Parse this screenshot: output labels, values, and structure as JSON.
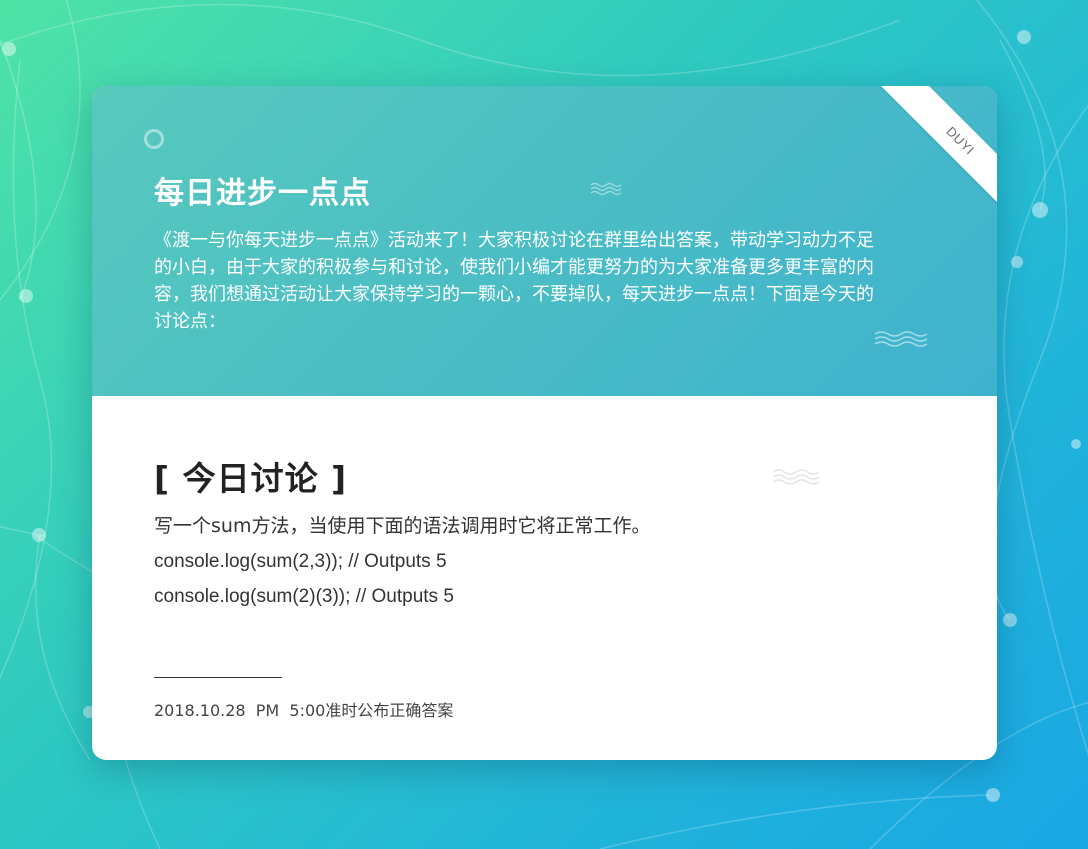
{
  "colors": {
    "background_start": "#4fe3a6",
    "background_end": "#19a7e4",
    "header_start": "#58c9bd",
    "header_end": "#3fb2d0",
    "card_bg": "#ffffff"
  },
  "ribbon": {
    "text": "DUYI"
  },
  "header": {
    "title": "每日进步一点点",
    "intro": "《渡一与你每天进步一点点》活动来了！大家积极讨论在群里给出答案，带动学习动力不足的小白，由于大家的积极参与和讨论，使我们小编才能更努力的为大家准备更多更丰富的内容，我们想通过活动让大家保持学习的一颗心，不要掉队，每天进步一点点！下面是今天的讨论点："
  },
  "discussion": {
    "title": "[ 今日讨论 ]",
    "lines": [
      "写一个sum方法，当使用下面的语法调用时它将正常工作。",
      "console.log(sum(2,3)); // Outputs 5",
      "console.log(sum(2)(3)); // Outputs 5"
    ]
  },
  "footer": {
    "text": "2018.10.28  PM  5:00准时公布正确答案"
  },
  "icons": [
    "ring-icon",
    "wave-icon"
  ]
}
